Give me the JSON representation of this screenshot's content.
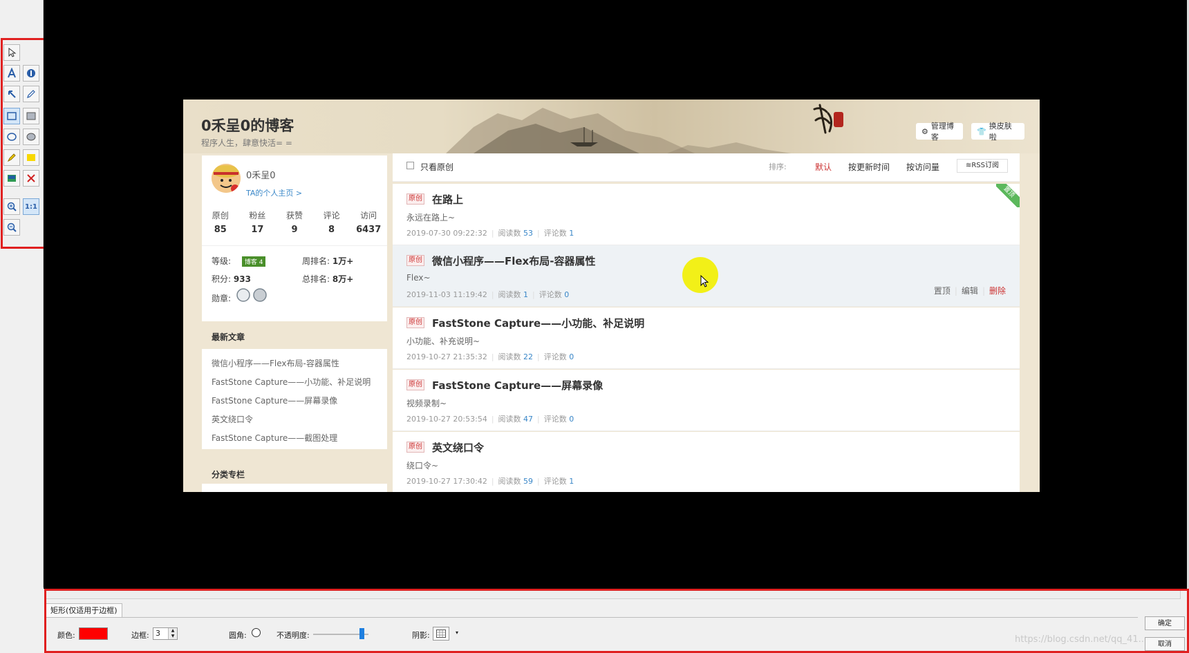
{
  "blog": {
    "title": "0禾呈0的博客",
    "subtitle": "程序人生，肆意快活= =",
    "manage_btn": "管理博客",
    "skin_btn": "换皮肤啦",
    "profile": {
      "name": "0禾呈0",
      "home_link": "TA的个人主页 >",
      "stats": [
        {
          "label": "原创",
          "value": "85"
        },
        {
          "label": "粉丝",
          "value": "17"
        },
        {
          "label": "获赞",
          "value": "9"
        },
        {
          "label": "评论",
          "value": "8"
        },
        {
          "label": "访问",
          "value": "6437"
        }
      ],
      "level_label": "等级:",
      "level_badge": "博客 4",
      "points_label": "积分:",
      "points": "933",
      "week_rank_label": "周排名:",
      "week_rank": "1万+",
      "total_rank_label": "总排名:",
      "total_rank": "8万+",
      "medals_label": "勋章:"
    },
    "recent": {
      "title": "最新文章",
      "items": [
        "微信小程序——Flex布局-容器属性",
        "FastStone Capture——小功能、补足说明",
        "FastStone Capture——屏幕录像",
        "英文绕口令",
        "FastStone Capture——截图处理"
      ]
    },
    "category_title": "分类专栏",
    "filter": {
      "original_only": "只看原创",
      "sort_label": "排序:",
      "sort_default": "默认",
      "sort_time": "按更新时间",
      "sort_views": "按访问量",
      "rss": "RSS订阅"
    },
    "posts": [
      {
        "tag": "原创",
        "title": "在路上",
        "desc": "永远在路上~",
        "date": "2019-07-30 09:22:32",
        "views_label": "阅读数",
        "views": "53",
        "comments_label": "评论数",
        "comments": "1",
        "ribbon": "置顶"
      },
      {
        "tag": "原创",
        "title": "微信小程序——Flex布局-容器属性",
        "desc": "Flex~",
        "date": "2019-11-03 11:19:42",
        "views_label": "阅读数",
        "views": "1",
        "comments_label": "评论数",
        "comments": "0",
        "actions": {
          "pin": "置顶",
          "edit": "编辑",
          "delete": "删除"
        }
      },
      {
        "tag": "原创",
        "title": "FastStone Capture——小功能、补足说明",
        "desc": "小功能、补充说明~",
        "date": "2019-10-27 21:35:32",
        "views_label": "阅读数",
        "views": "22",
        "comments_label": "评论数",
        "comments": "0"
      },
      {
        "tag": "原创",
        "title": "FastStone Capture——屏幕录像",
        "desc": "视频录制~",
        "date": "2019-10-27 20:53:54",
        "views_label": "阅读数",
        "views": "47",
        "comments_label": "评论数",
        "comments": "0"
      },
      {
        "tag": "原创",
        "title": "英文绕口令",
        "desc": "绕口令~",
        "date": "2019-10-27 17:30:42",
        "views_label": "阅读数",
        "views": "59",
        "comments_label": "评论数",
        "comments": "1"
      }
    ]
  },
  "panel": {
    "tab": "矩形(仅适用于边框)",
    "color_label": "颜色:",
    "color_value": "#ff0000",
    "border_label": "边框:",
    "border_value": "3",
    "round_label": "圆角:",
    "opacity_label": "不透明度:",
    "opacity_value": 0.88,
    "shadow_label": "阴影:",
    "ok": "确定",
    "cancel": "取消"
  },
  "watermark": "https://blog.csdn.net/qq_41..."
}
